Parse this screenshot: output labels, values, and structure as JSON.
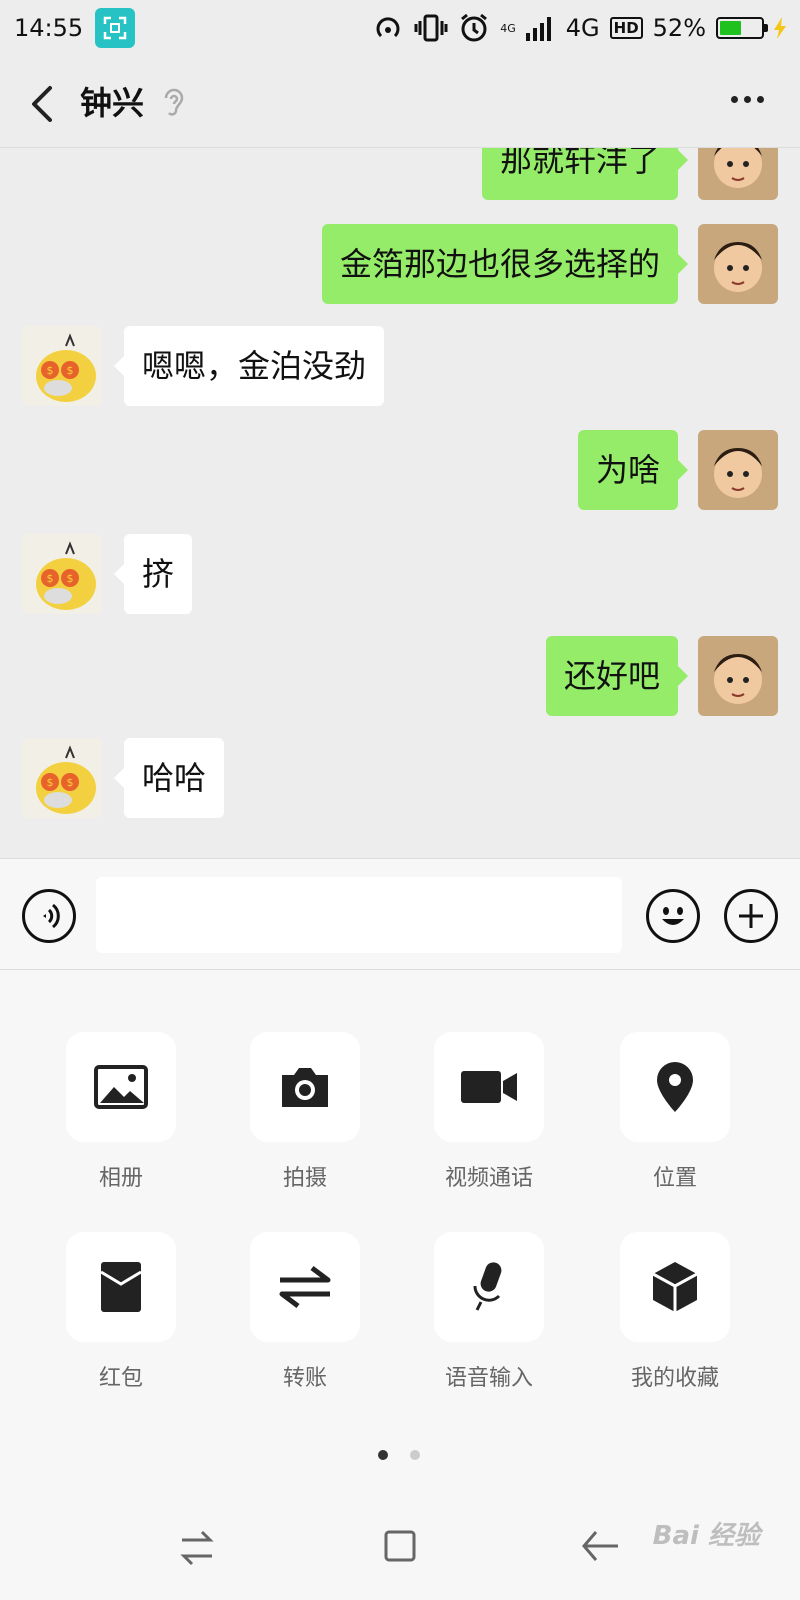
{
  "status_bar": {
    "time": "14:55",
    "network": "4G",
    "hd": "HD",
    "battery_percent": "52%",
    "battery_level": 0.52,
    "signal_small": "4G"
  },
  "header": {
    "title": "钟兴"
  },
  "messages": [
    {
      "sender": "me",
      "text": "那就轩沣了"
    },
    {
      "sender": "me",
      "text": "金箔那边也很多选择的"
    },
    {
      "sender": "them",
      "text": "嗯嗯，金泊没劲"
    },
    {
      "sender": "me",
      "text": "为啥"
    },
    {
      "sender": "them",
      "text": "挤"
    },
    {
      "sender": "me",
      "text": "还好吧"
    },
    {
      "sender": "them",
      "text": "哈哈"
    }
  ],
  "input": {
    "placeholder": ""
  },
  "tools": [
    {
      "label": "相册",
      "icon": "image-icon"
    },
    {
      "label": "拍摄",
      "icon": "camera-icon"
    },
    {
      "label": "视频通话",
      "icon": "video-icon"
    },
    {
      "label": "位置",
      "icon": "location-icon"
    },
    {
      "label": "红包",
      "icon": "red-packet-icon"
    },
    {
      "label": "转账",
      "icon": "transfer-icon"
    },
    {
      "label": "语音输入",
      "icon": "microphone-icon"
    },
    {
      "label": "我的收藏",
      "icon": "favorites-icon"
    }
  ],
  "pager": {
    "page": 1,
    "total": 2
  },
  "watermark": "Bai 经验",
  "colors": {
    "background": "#ededed",
    "my_bubble": "#95ec69",
    "their_bubble": "#ffffff",
    "panel": "#f7f7f7",
    "screenshot_badge": "#27c3c4",
    "battery": "#1fc11f"
  }
}
